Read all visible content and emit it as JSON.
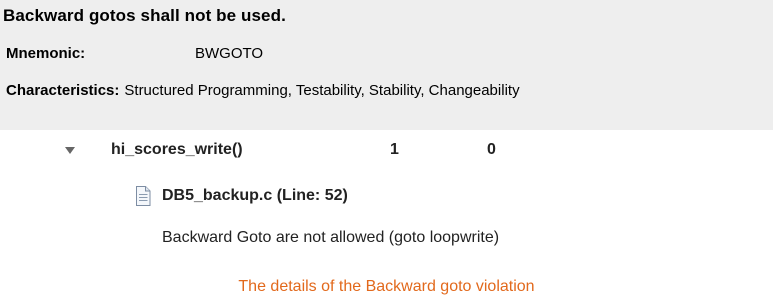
{
  "rule": {
    "title": "Backward gotos shall not be used.",
    "mnemonic_label": "Mnemonic:",
    "mnemonic_value": "BWGOTO",
    "characteristics_label": "Characteristics:",
    "characteristics_value": "Structured Programming, Testability, Stability, Changeability"
  },
  "tree": {
    "function_name": "hi_scores_write()",
    "count_1": "1",
    "count_2": "0",
    "file_label": "DB5_backup.c (Line: 52)",
    "violation_message": "Backward Goto are not allowed (goto loopwrite)"
  },
  "caption": "The details of the Backward goto violation",
  "colors": {
    "panel_background": "#eeeeee",
    "caption_text": "#e2691c"
  },
  "icons": {
    "expand": "chevron-down-icon",
    "file": "document-icon"
  }
}
